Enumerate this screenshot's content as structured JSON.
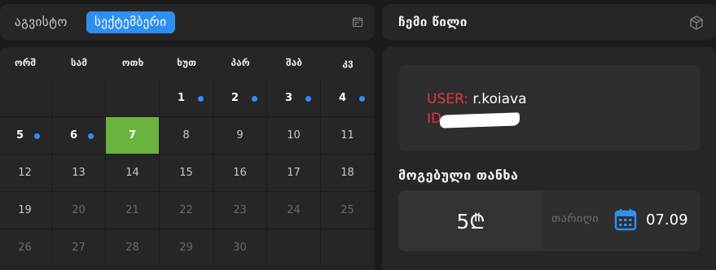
{
  "calendar": {
    "prev_month": "აგვისტო",
    "current_month": "სექტემბერი",
    "weekdays": [
      "ორშ",
      "სამ",
      "ოთხ",
      "ხუთ",
      "პარ",
      "შაბ",
      "კვ"
    ],
    "days": [
      {
        "n": ""
      },
      {
        "n": ""
      },
      {
        "n": ""
      },
      {
        "n": "1",
        "played": true
      },
      {
        "n": "2",
        "played": true
      },
      {
        "n": "3",
        "played": true
      },
      {
        "n": "4",
        "played": true
      },
      {
        "n": "5",
        "played": true
      },
      {
        "n": "6",
        "played": true
      },
      {
        "n": "7",
        "today": true
      },
      {
        "n": "8"
      },
      {
        "n": "9"
      },
      {
        "n": "10"
      },
      {
        "n": "11"
      },
      {
        "n": "12"
      },
      {
        "n": "13"
      },
      {
        "n": "14"
      },
      {
        "n": "15"
      },
      {
        "n": "16"
      },
      {
        "n": "17"
      },
      {
        "n": "18"
      },
      {
        "n": "19"
      },
      {
        "n": "20",
        "muted": true
      },
      {
        "n": "21",
        "muted": true
      },
      {
        "n": "22",
        "muted": true
      },
      {
        "n": "23",
        "muted": true
      },
      {
        "n": "24",
        "muted": true
      },
      {
        "n": "25",
        "muted": true
      },
      {
        "n": "26",
        "muted": true
      },
      {
        "n": "27",
        "muted": true
      },
      {
        "n": "28",
        "muted": true
      },
      {
        "n": "29",
        "muted": true
      },
      {
        "n": "30",
        "muted": true
      },
      {
        "n": ""
      },
      {
        "n": ""
      }
    ],
    "icon": "calendar-icon"
  },
  "share": {
    "title": "ჩემი წილი",
    "icon": "cube-icon",
    "user_label": "USER:",
    "user_value": "r.koiava",
    "id_label": "ID:",
    "won_label": "მოგებული თანხა",
    "amount": "5₾",
    "date_label": "თარიღი",
    "date_value": "07.09"
  },
  "colors": {
    "accent": "#2f8ff0",
    "today": "#6ab33e",
    "label_red": "#e0383e",
    "panel": "#262626",
    "background": "#1b1b1b"
  }
}
